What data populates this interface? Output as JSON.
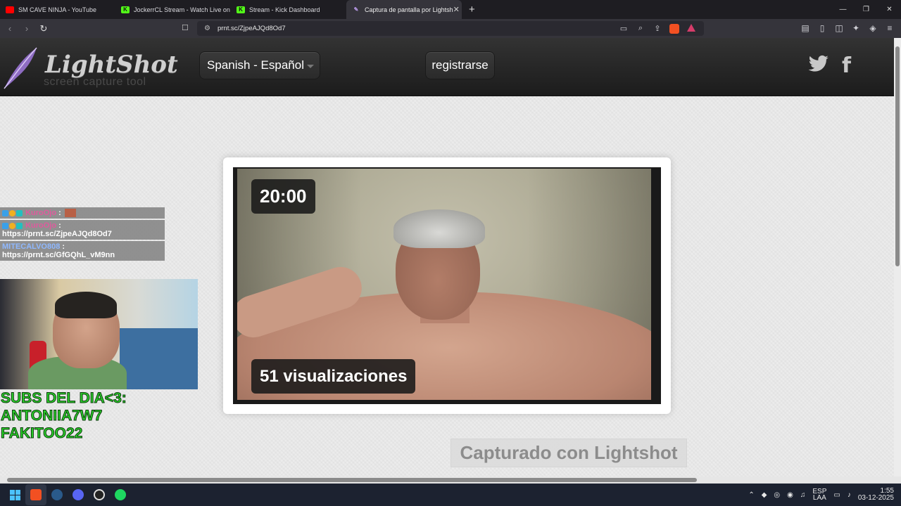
{
  "tabs": [
    {
      "title": "SM CAVE NINJA - YouTube",
      "favicon_color": "#ff0000"
    },
    {
      "title": "JockerrCL Stream - Watch Live on Ki",
      "favicon_color": "#53fc18"
    },
    {
      "title": "Stream - Kick Dashboard",
      "favicon_color": "#53fc18"
    },
    {
      "title": "Captura de pantalla por Lightsh",
      "favicon_color": "#9b7fd1",
      "active": true
    }
  ],
  "address": {
    "url": "prnt.sc/ZjpeAJQd8Od7"
  },
  "header": {
    "logo_name": "LightShot",
    "logo_tagline": "screen capture tool",
    "language_button": "Spanish - Español",
    "register_button": "registrarse"
  },
  "screenshot": {
    "timer": "20:00",
    "views": "51 visualizaciones"
  },
  "footer": {
    "captured_with": "Capturado con Lightshot"
  },
  "overlay": {
    "chat": [
      {
        "user": "KuroOjo",
        "message": ""
      },
      {
        "user": "KuroOjo",
        "message": "https://prnt.sc/ZjpeAJQd8Od7"
      },
      {
        "user": "MITECALVO808",
        "message": "https://prnt.sc/GfGQhL_vM9nn"
      }
    ],
    "subs_title": "SUBS DEL DIA<3:",
    "subs": [
      "ANTONIIA7W7",
      "FAKITOO22"
    ]
  },
  "taskbar": {
    "language": "ESP",
    "layout": "LAA",
    "time": "1:55",
    "date": "03-12-2025"
  },
  "colors": {
    "accent_subs": "#2bd12b",
    "chat_user": "#e05a9d"
  }
}
